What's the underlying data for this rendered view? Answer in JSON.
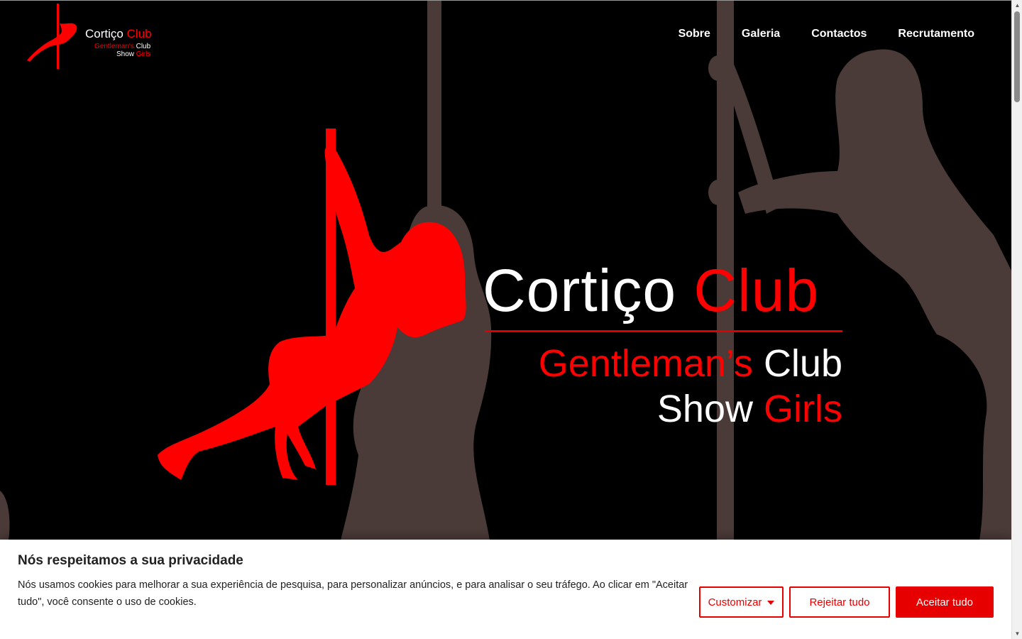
{
  "header": {
    "logo": {
      "title_part1": "Cortiço",
      "title_part2": "Club",
      "sub1_part1": "Gentleman's",
      "sub1_part2": "Club",
      "sub2_part1": "Show",
      "sub2_part2": "Girls"
    },
    "nav": [
      {
        "label": "Sobre"
      },
      {
        "label": "Galeria"
      },
      {
        "label": "Contactos"
      },
      {
        "label": "Recrutamento"
      }
    ]
  },
  "hero": {
    "title_part1": "Cortiço",
    "title_part2": "Club",
    "line1_part1": "Gentleman’s",
    "line1_part2": "Club",
    "line2_part1": "Show",
    "line2_part2": "Girls"
  },
  "cookie_banner": {
    "title": "Nós respeitamos a sua privacidade",
    "text": "Nós usamos cookies para melhorar a sua experiência de pesquisa, para personalizar anúncios, e para analisar o seu tráfego. Ao clicar em \"Aceitar tudo\", você consente o uso de cookies.",
    "customize_label": "Customizar",
    "reject_label": "Rejeitar tudo",
    "accept_label": "Aceitar tudo"
  },
  "colors": {
    "brand_red": "#ff0000",
    "background": "#000000",
    "silhouette": "#4a3a38"
  }
}
